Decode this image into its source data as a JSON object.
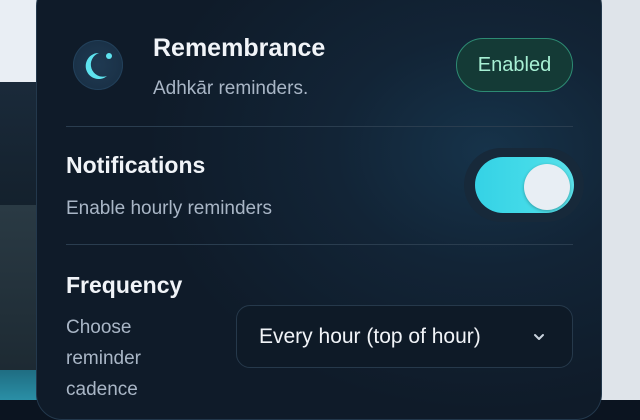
{
  "header": {
    "title": "Remembrance",
    "subtitle": "Adhkār reminders.",
    "status_badge": "Enabled"
  },
  "notifications": {
    "title": "Notifications",
    "description": "Enable hourly reminders",
    "enabled": true
  },
  "frequency": {
    "title": "Frequency",
    "description_lines": [
      "Choose",
      "reminder",
      "cadence"
    ],
    "selected": "Every hour (top of hour)"
  },
  "colors": {
    "accent": "#45dbe8",
    "badge_text": "#a7f0d4",
    "badge_border": "#2d8b73",
    "panel_bg": "#122436"
  },
  "icons": {
    "logo": "crescent-moon-icon",
    "select": "chevron-down-icon"
  }
}
